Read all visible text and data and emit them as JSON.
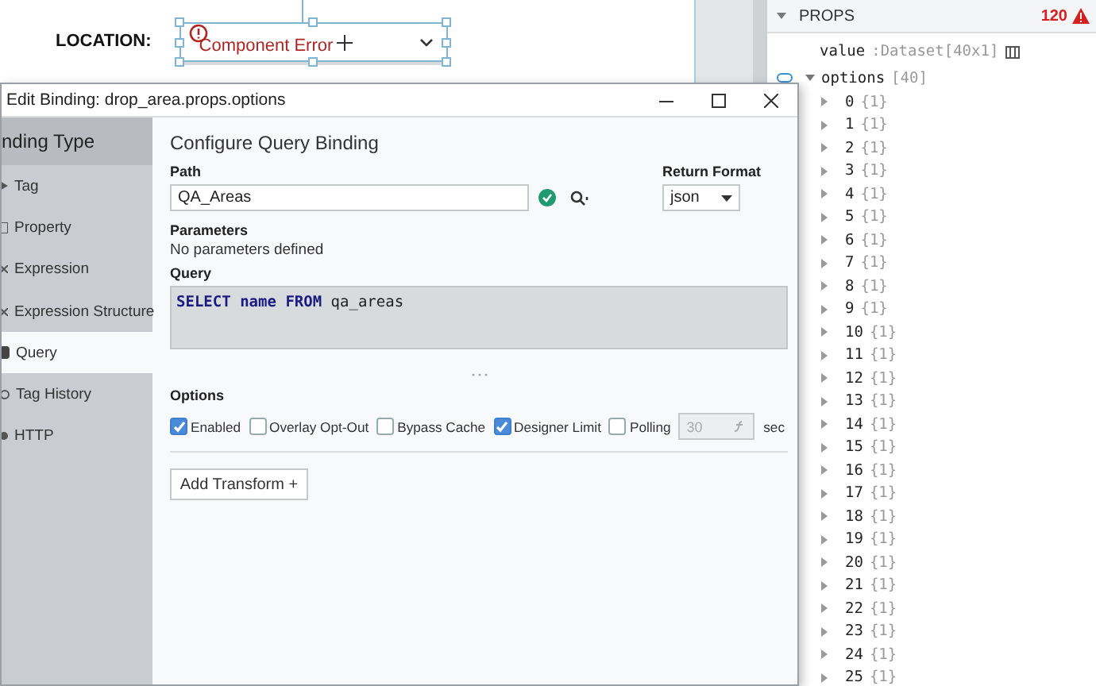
{
  "designer": {
    "label": "LOCATION:",
    "dropdown": {
      "text": "Component Error",
      "selected": true
    }
  },
  "props": {
    "title": "PROPS",
    "warning_count": "120",
    "expanded": true,
    "value": {
      "name": "value",
      "text": ":Dataset[40x1]"
    },
    "options": {
      "name": "options",
      "count": "[40]",
      "expanded": true,
      "bound": true,
      "items": [
        {
          "index": "0",
          "count": "{1}",
          "expanded": false
        },
        {
          "index": "1",
          "count": "{1}",
          "expanded": false
        },
        {
          "index": "2",
          "count": "{1}",
          "expanded": false
        },
        {
          "index": "3",
          "count": "{1}",
          "expanded": false
        },
        {
          "index": "4",
          "count": "{1}",
          "expanded": false
        },
        {
          "index": "5",
          "count": "{1}",
          "expanded": false
        },
        {
          "index": "6",
          "count": "{1}",
          "expanded": false
        },
        {
          "index": "7",
          "count": "{1}",
          "expanded": false
        },
        {
          "index": "8",
          "count": "{1}",
          "expanded": false
        },
        {
          "index": "9",
          "count": "{1}",
          "expanded": false
        },
        {
          "index": "10",
          "count": "{1}",
          "expanded": false
        },
        {
          "index": "11",
          "count": "{1}",
          "expanded": false
        },
        {
          "index": "12",
          "count": "{1}",
          "expanded": false
        },
        {
          "index": "13",
          "count": "{1}",
          "expanded": false
        },
        {
          "index": "14",
          "count": "{1}",
          "expanded": false
        },
        {
          "index": "15",
          "count": "{1}",
          "expanded": false
        },
        {
          "index": "16",
          "count": "{1}",
          "expanded": false
        },
        {
          "index": "17",
          "count": "{1}",
          "expanded": false
        },
        {
          "index": "18",
          "count": "{1}",
          "expanded": false
        },
        {
          "index": "19",
          "count": "{1}",
          "expanded": false
        },
        {
          "index": "20",
          "count": "{1}",
          "expanded": false
        },
        {
          "index": "21",
          "count": "{1}",
          "expanded": false
        },
        {
          "index": "22",
          "count": "{1}",
          "expanded": false
        },
        {
          "index": "23",
          "count": "{1}",
          "expanded": false
        },
        {
          "index": "24",
          "count": "{1}",
          "expanded": false
        },
        {
          "index": "25",
          "count": "{1}",
          "expanded": false
        }
      ]
    }
  },
  "dialog": {
    "title": "Edit Binding: drop_area.props.options",
    "sidebar": {
      "title": "nding Type",
      "items": [
        {
          "label": "Tag",
          "selected": false
        },
        {
          "label": "Property",
          "selected": false
        },
        {
          "label": "Expression",
          "selected": false
        },
        {
          "label": "Expression Structure",
          "selected": false
        },
        {
          "label": "Query",
          "selected": true
        },
        {
          "label": "Tag History",
          "selected": false
        },
        {
          "label": "HTTP",
          "selected": false
        }
      ]
    },
    "heading": "Configure Query Binding",
    "path": {
      "label": "Path",
      "value": "QA_Areas",
      "valid": true
    },
    "return_format": {
      "label": "Return Format",
      "value": "json"
    },
    "parameters": {
      "label": "Parameters",
      "text": "No parameters defined"
    },
    "query": {
      "label": "Query",
      "code": "**SELECT** **name** **FROM** qa_areas"
    },
    "options": {
      "label": "Options",
      "checkboxes": [
        {
          "label": "Enabled",
          "checked": true
        },
        {
          "label": "Overlay Opt-Out",
          "checked": false
        },
        {
          "label": "Bypass Cache",
          "checked": false
        },
        {
          "label": "Designer Limit",
          "checked": true
        },
        {
          "label": "Polling",
          "checked": false
        }
      ],
      "polling_field": {
        "value": "30",
        "disabled": true
      },
      "unit": "sec"
    },
    "add_transform": "Add Transform +"
  }
}
